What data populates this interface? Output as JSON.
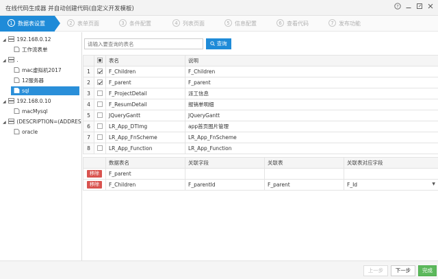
{
  "window": {
    "title": "在线代码生成器 并自动创建代码(自定义开发模板)",
    "icons": [
      "help-icon",
      "minimize-icon",
      "maximize-icon",
      "close-icon"
    ]
  },
  "steps": [
    {
      "num": "1",
      "label": "数据表设置",
      "active": true
    },
    {
      "num": "2",
      "label": "表单页面"
    },
    {
      "num": "3",
      "label": "条件配置"
    },
    {
      "num": "4",
      "label": "列表页面"
    },
    {
      "num": "5",
      "label": "信息配置"
    },
    {
      "num": "6",
      "label": "查看代码"
    },
    {
      "num": "7",
      "label": "发布功能"
    }
  ],
  "tree": [
    {
      "label": "192.168.0.12",
      "expander": "◢",
      "icon": "server-icon"
    },
    {
      "label": "工作流表单",
      "icon": "database-icon"
    },
    {
      "label": ".",
      "expander": "◢",
      "icon": "server-icon"
    },
    {
      "label": "mac虚拟机2017",
      "icon": "database-icon"
    },
    {
      "label": "12服务器",
      "icon": "database-icon"
    },
    {
      "label": "sql",
      "icon": "database-icon",
      "selected": true
    },
    {
      "label": "192.168.0.10",
      "expander": "◢",
      "icon": "server-icon"
    },
    {
      "label": "macMysql",
      "icon": "database-icon"
    },
    {
      "label": "(DESCRIPTION=(ADDRESS=(",
      "expander": "◢",
      "icon": "server-icon"
    },
    {
      "label": "oracle",
      "icon": "database-icon"
    }
  ],
  "search": {
    "placeholder": "请输入要查询的表名",
    "button": "查询",
    "button_icon": "search-icon"
  },
  "table1": {
    "headers": [
      "",
      "",
      "表名",
      "说明"
    ],
    "rows": [
      {
        "num": "1",
        "checked": true,
        "name": "F_Children",
        "desc": "F_Children"
      },
      {
        "num": "2",
        "checked": true,
        "name": "F_parent",
        "desc": "F_parent"
      },
      {
        "num": "3",
        "checked": false,
        "name": "F_ProjectDetail",
        "desc": "派工信息"
      },
      {
        "num": "4",
        "checked": false,
        "name": "F_ResumDetail",
        "desc": "报销单明细"
      },
      {
        "num": "5",
        "checked": false,
        "name": "JQueryGantt",
        "desc": "JQueryGantt"
      },
      {
        "num": "6",
        "checked": false,
        "name": "LR_App_DTImg",
        "desc": "app首页图片管理"
      },
      {
        "num": "7",
        "checked": false,
        "name": "LR_App_FnScheme",
        "desc": "LR_App_FnScheme"
      },
      {
        "num": "8",
        "checked": false,
        "name": "LR_App_Function",
        "desc": "LR_App_Function"
      }
    ]
  },
  "table2": {
    "headers": [
      "",
      "数据表名",
      "关联字段",
      "关联表",
      "关联表对应字段"
    ],
    "rows": [
      {
        "action": "移除",
        "table": "F_parent",
        "field": "",
        "rel_table": "",
        "rel_field": "",
        "dropdown": false
      },
      {
        "action": "移除",
        "table": "F_Children",
        "field": "F_parentId",
        "rel_table": "F_parent",
        "rel_field": "F_Id",
        "dropdown": true
      }
    ]
  },
  "footer": {
    "prev": "上一步",
    "next": "下一步",
    "finish": "完成"
  },
  "colors": {
    "accent": "#1f8bd8",
    "danger": "#d9534f",
    "success": "#5cb85c"
  }
}
